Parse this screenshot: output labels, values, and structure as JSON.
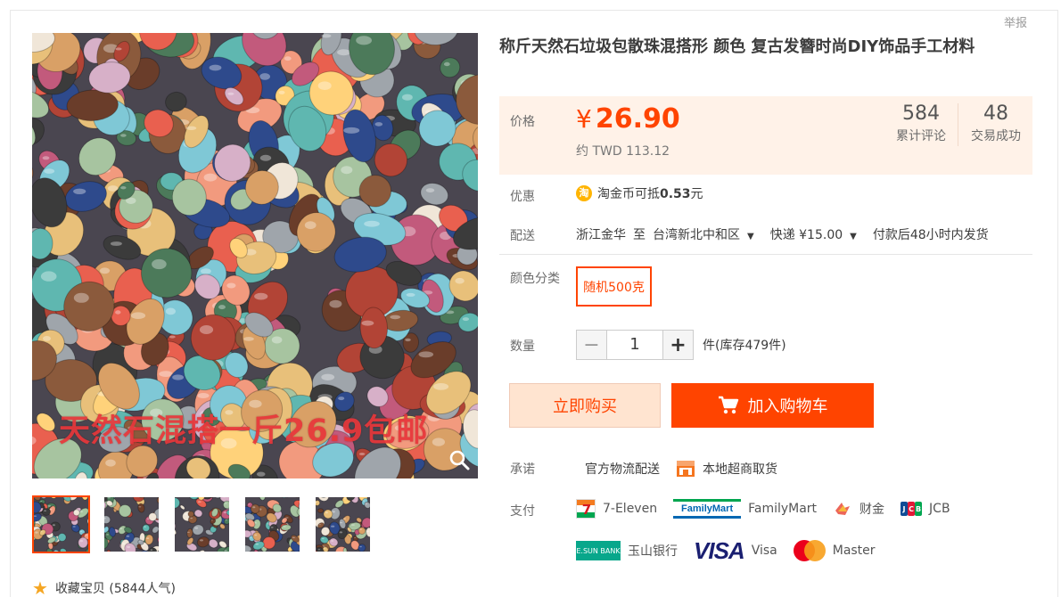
{
  "report_label": "举报",
  "product": {
    "title": "称斤天然石垃圾包散珠混搭形 颜色 复古发簪时尚DIY饰品手工材料",
    "image_overlay_text": "天然石混搭一斤26.9包邮"
  },
  "gallery": {
    "thumbnails": [
      "thumbnail-1",
      "thumbnail-2",
      "thumbnail-3",
      "thumbnail-4",
      "thumbnail-5"
    ],
    "selected_index": 0
  },
  "favorite": {
    "label": "收藏宝贝 (5844人气)"
  },
  "price": {
    "label": "价格",
    "currency_symbol": "¥",
    "amount": "26.90",
    "approx": "约 TWD 113.12"
  },
  "stats": {
    "reviews_count": "584",
    "reviews_label": "累计评论",
    "trades_count": "48",
    "trades_label": "交易成功"
  },
  "promotion": {
    "label": "优惠",
    "icon_text": "淘",
    "text_prefix": "淘金币可抵",
    "amount": "0.53",
    "text_suffix": "元"
  },
  "shipping": {
    "label": "配送",
    "from": "浙江金华",
    "to_word": "至",
    "destination": "台湾新北中和区",
    "method": "快递 ¥15.00",
    "dispatch": "付款后48小时内发货"
  },
  "sku": {
    "label": "颜色分类",
    "selected_option": "随机500克"
  },
  "quantity": {
    "label": "数量",
    "minus": "−",
    "value": "1",
    "plus": "+",
    "stock": "件(库存479件)"
  },
  "actions": {
    "buy_now": "立即购买",
    "add_to_cart": "加入购物车"
  },
  "promise": {
    "label": "承诺",
    "logistics": "官方物流配送",
    "pickup": "本地超商取货"
  },
  "payment": {
    "label": "支付",
    "methods": {
      "seven": "7-Eleven",
      "familymart_logo": "FamilyMart",
      "familymart": "FamilyMart",
      "caijin": "财金",
      "jcb": "JCB",
      "esun_logo": "E.SUN BANK",
      "esun": "玉山银行",
      "visa_logo": "VISA",
      "visa": "Visa",
      "master": "Master"
    }
  },
  "colors": {
    "accent": "#ff4400",
    "price_bg": "#fff2e8",
    "buy_now_bg": "#ffe4d0"
  }
}
